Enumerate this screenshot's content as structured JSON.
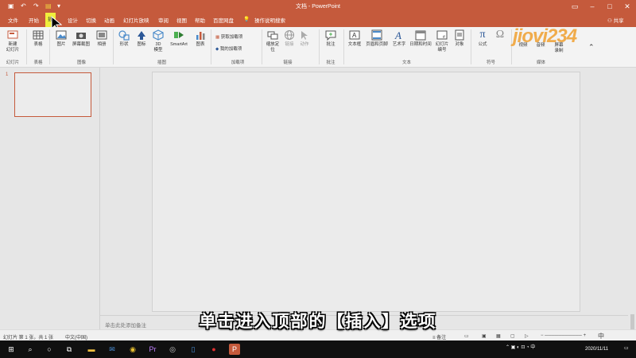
{
  "window": {
    "title": "文档  -  PowerPoint",
    "share_label": "共享"
  },
  "menu_tabs": [
    {
      "label": "文件"
    },
    {
      "label": "开始"
    },
    {
      "label": "插"
    },
    {
      "label": "设计"
    },
    {
      "label": "切换"
    },
    {
      "label": "动画"
    },
    {
      "label": "幻灯片放映"
    },
    {
      "label": "审阅"
    },
    {
      "label": "视图"
    },
    {
      "label": "帮助"
    },
    {
      "label": "百度网盘"
    },
    {
      "label": "操作说明搜索"
    }
  ],
  "ribbon": {
    "new_slide": "新建\n幻灯片",
    "table": "表格",
    "image": "图片",
    "screenshot": "屏幕截图",
    "album": "相册",
    "shape": "形状",
    "icon": "图标",
    "model3d": "3D\n模型",
    "smartart": "SmartArt",
    "chart": "图表",
    "get_addins": "获取加载项",
    "my_addins": "我的加载项",
    "zoom": "缩放定\n位",
    "link": "链接",
    "action": "动作",
    "comment": "批注",
    "textbox": "文本框",
    "header_footer": "页眉和页脚",
    "wordart": "艺术字",
    "datetime": "日期和时间",
    "slide_number": "幻灯片\n编号",
    "object": "对象",
    "equation": "公式",
    "symbol": "符号",
    "video": "视频",
    "audio": "音频",
    "screen_record": "屏幕\n录制",
    "groups": {
      "slides": "幻灯片",
      "tables": "表格",
      "images": "图像",
      "illustrations": "插图",
      "addins": "加载项",
      "links": "链接",
      "comments": "批注",
      "text": "文本",
      "symbols": "符号",
      "media": "媒体"
    }
  },
  "slides_pane": {
    "slide_number": "1"
  },
  "notes_placeholder": "单击此处添加备注",
  "status": {
    "slide_info": "幻灯片 第 1 张，共 1 张",
    "language": "中文(中国)",
    "notes_btn": "备注",
    "ime": "中"
  },
  "caption": "单击进入顶部的【插入】选项",
  "taskbar": {
    "date": "2020/11/11"
  },
  "watermark": "jiovi234",
  "colors": {
    "accent": "#c55a3c",
    "highlight": "#f0ee3c"
  }
}
